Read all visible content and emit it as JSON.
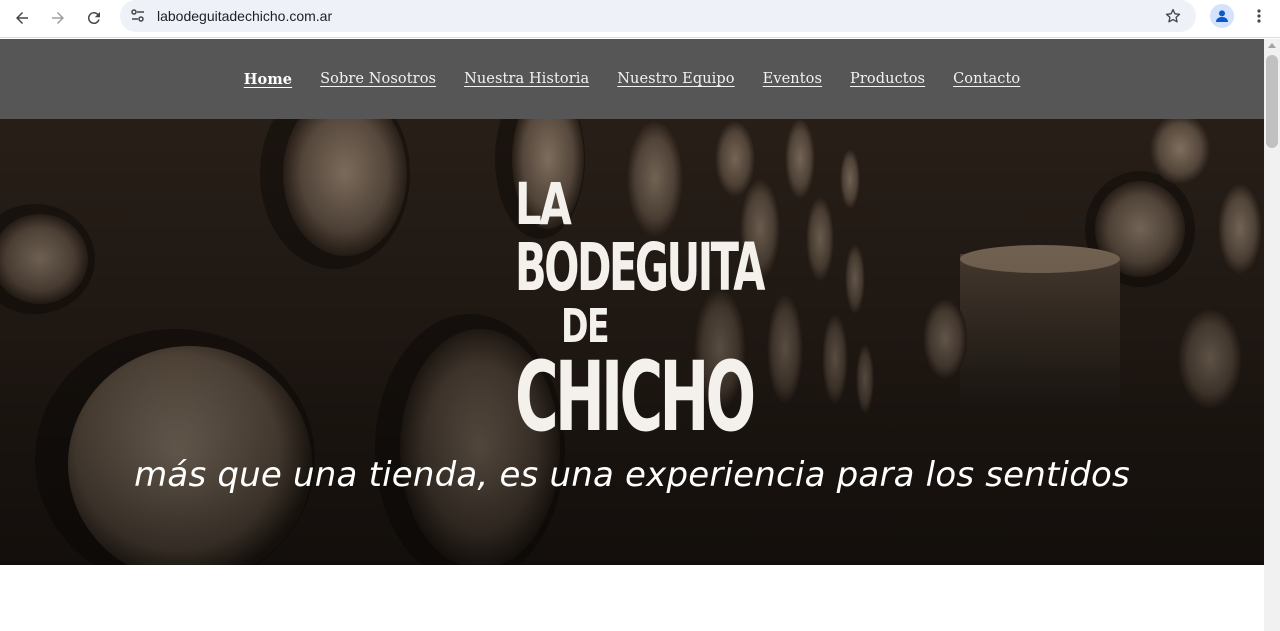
{
  "browser": {
    "url": "labodeguitadechicho.com.ar",
    "icons": {
      "back": "back-arrow-icon",
      "forward": "forward-arrow-icon",
      "reload": "reload-icon",
      "site_info": "tune-icon",
      "bookmark": "star-icon",
      "profile": "person-icon",
      "menu": "three-dots-icon"
    }
  },
  "nav": {
    "items": [
      {
        "label": "Home",
        "active": true
      },
      {
        "label": "Sobre Nosotros"
      },
      {
        "label": "Nuestra Historia"
      },
      {
        "label": "Nuestro Equipo"
      },
      {
        "label": "Eventos"
      },
      {
        "label": "Productos"
      },
      {
        "label": "Contacto"
      }
    ],
    "bg_color": "#565656"
  },
  "hero": {
    "logo": {
      "line1": "LA",
      "line2": "BODEGUITA",
      "line3": "DE",
      "line4": "CHICHO"
    },
    "tagline": "más que una tienda, es una experiencia para los sentidos"
  }
}
